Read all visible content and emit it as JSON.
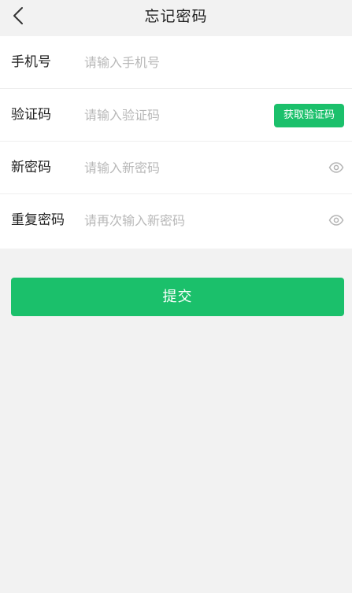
{
  "nav": {
    "title": "忘记密码",
    "back_icon": "chevron-left-icon"
  },
  "form": {
    "phone": {
      "label": "手机号",
      "placeholder": "请输入手机号",
      "value": ""
    },
    "code": {
      "label": "验证码",
      "placeholder": "请输入验证码",
      "value": "",
      "button_label": "获取验证码"
    },
    "new_password": {
      "label": "新密码",
      "placeholder": "请输入新密码",
      "value": "",
      "toggle_icon": "eye-icon"
    },
    "confirm_password": {
      "label": "重复密码",
      "placeholder": "请再次输入新密码",
      "value": "",
      "toggle_icon": "eye-icon"
    }
  },
  "submit": {
    "label": "提交"
  },
  "colors": {
    "accent": "#1bc06b",
    "background": "#f2f2f2",
    "placeholder": "#b8b8b8"
  }
}
